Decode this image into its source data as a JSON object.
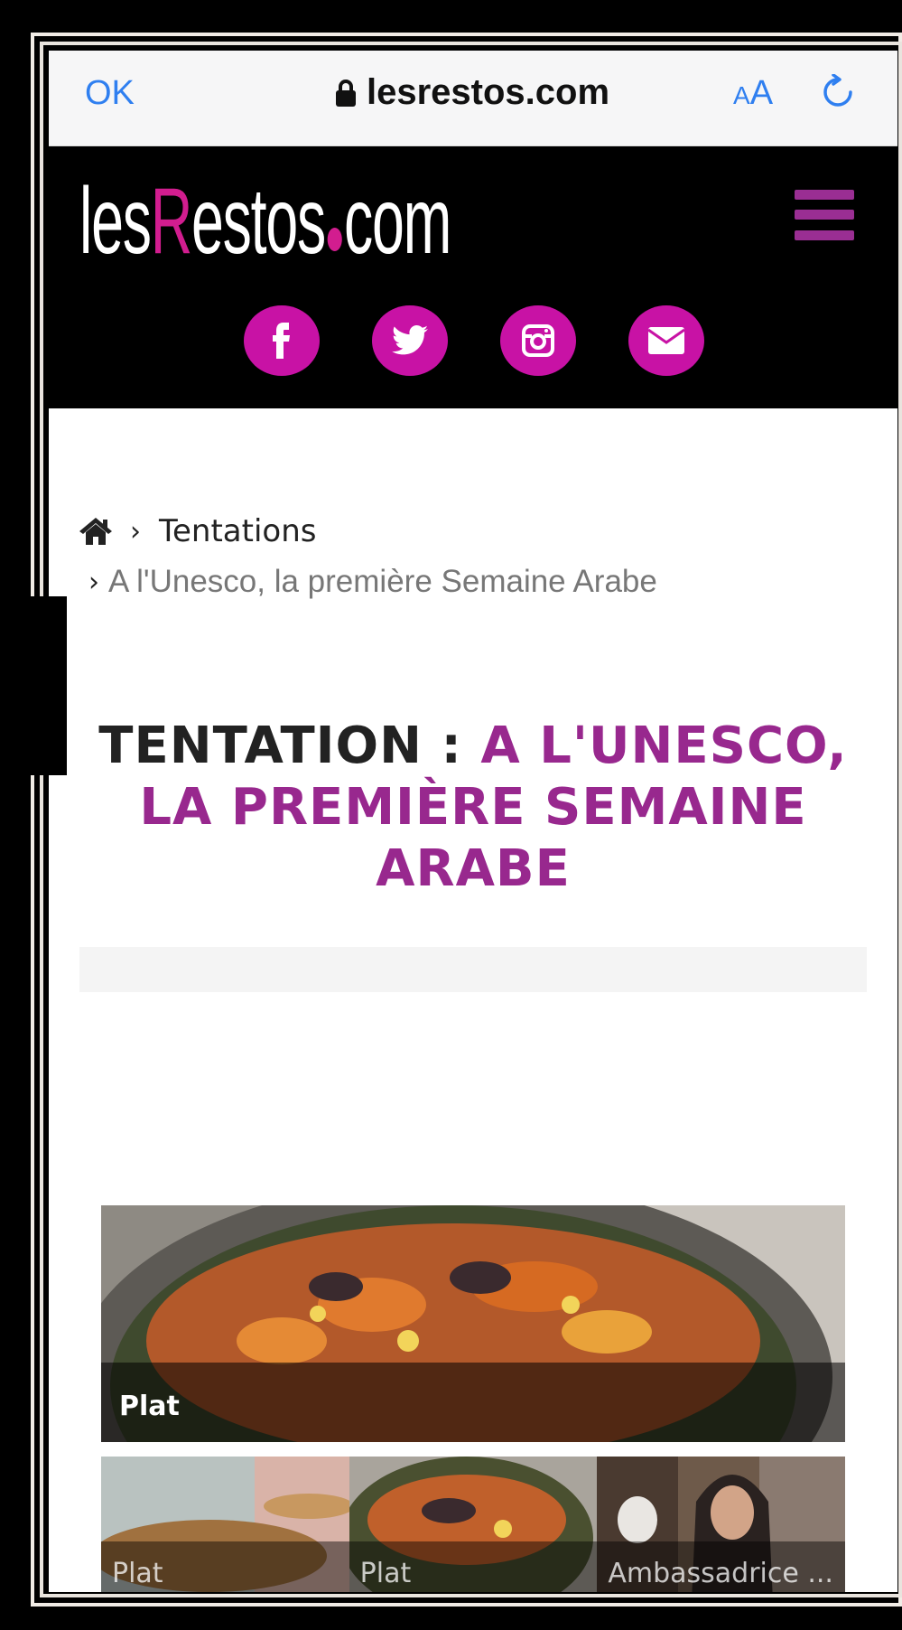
{
  "browser": {
    "done_label": "OK",
    "url": "lesrestos.com",
    "text_size_small": "A",
    "text_size_large": "A"
  },
  "site": {
    "logo_part1": "les",
    "logo_r": "R",
    "logo_part2": "estos",
    "logo_part3": "com",
    "brand_color": "#c812a5",
    "accent_color": "#98288e",
    "social": [
      "facebook-icon",
      "twitter-icon",
      "instagram-icon",
      "envelope-icon"
    ]
  },
  "breadcrumb": {
    "section": "Tentations",
    "current": "A l'Unesco, la première Semaine Arabe"
  },
  "article": {
    "title_prefix": "TENTATION : ",
    "title_main": "A L'UNESCO, LA PREMIÈRE SEMAINE ARABE"
  },
  "gallery": {
    "hero_label": "Plat",
    "thumbs": [
      {
        "label": "Plat"
      },
      {
        "label": "Plat"
      },
      {
        "label": "Ambassadrice ..."
      }
    ]
  }
}
